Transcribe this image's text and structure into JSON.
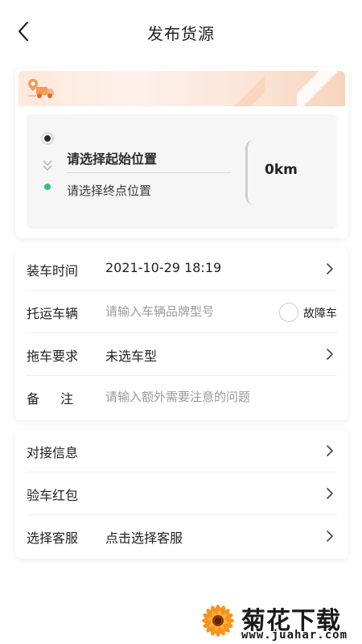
{
  "header": {
    "title": "发布货源",
    "back_icon": "chevron-left-icon"
  },
  "route": {
    "banner_icon": "truck-location-icon",
    "start_placeholder": "请选择起始位置",
    "end_placeholder": "请选择终点位置",
    "distance": "0km",
    "colors": {
      "end_dot": "#2ec27e",
      "banner": "#fde8da"
    }
  },
  "form": {
    "load_time": {
      "label": "装车时间",
      "value": "2021-10-29 18:19"
    },
    "vehicle": {
      "label": "托运车辆",
      "placeholder": "请输入车辆品牌型号",
      "fault_label": "故障车"
    },
    "tow_req": {
      "label": "拖车要求",
      "value": "未选车型"
    },
    "remark": {
      "label": "备注",
      "placeholder": "请输入额外需要注意的问题"
    }
  },
  "contact": {
    "handover": {
      "label": "对接信息"
    },
    "inspection": {
      "label": "验车红包"
    },
    "service": {
      "label": "选择客服",
      "value": "点击选择客服"
    }
  },
  "watermark": {
    "title": "菊花下载网",
    "url": "www.juahar.com"
  }
}
